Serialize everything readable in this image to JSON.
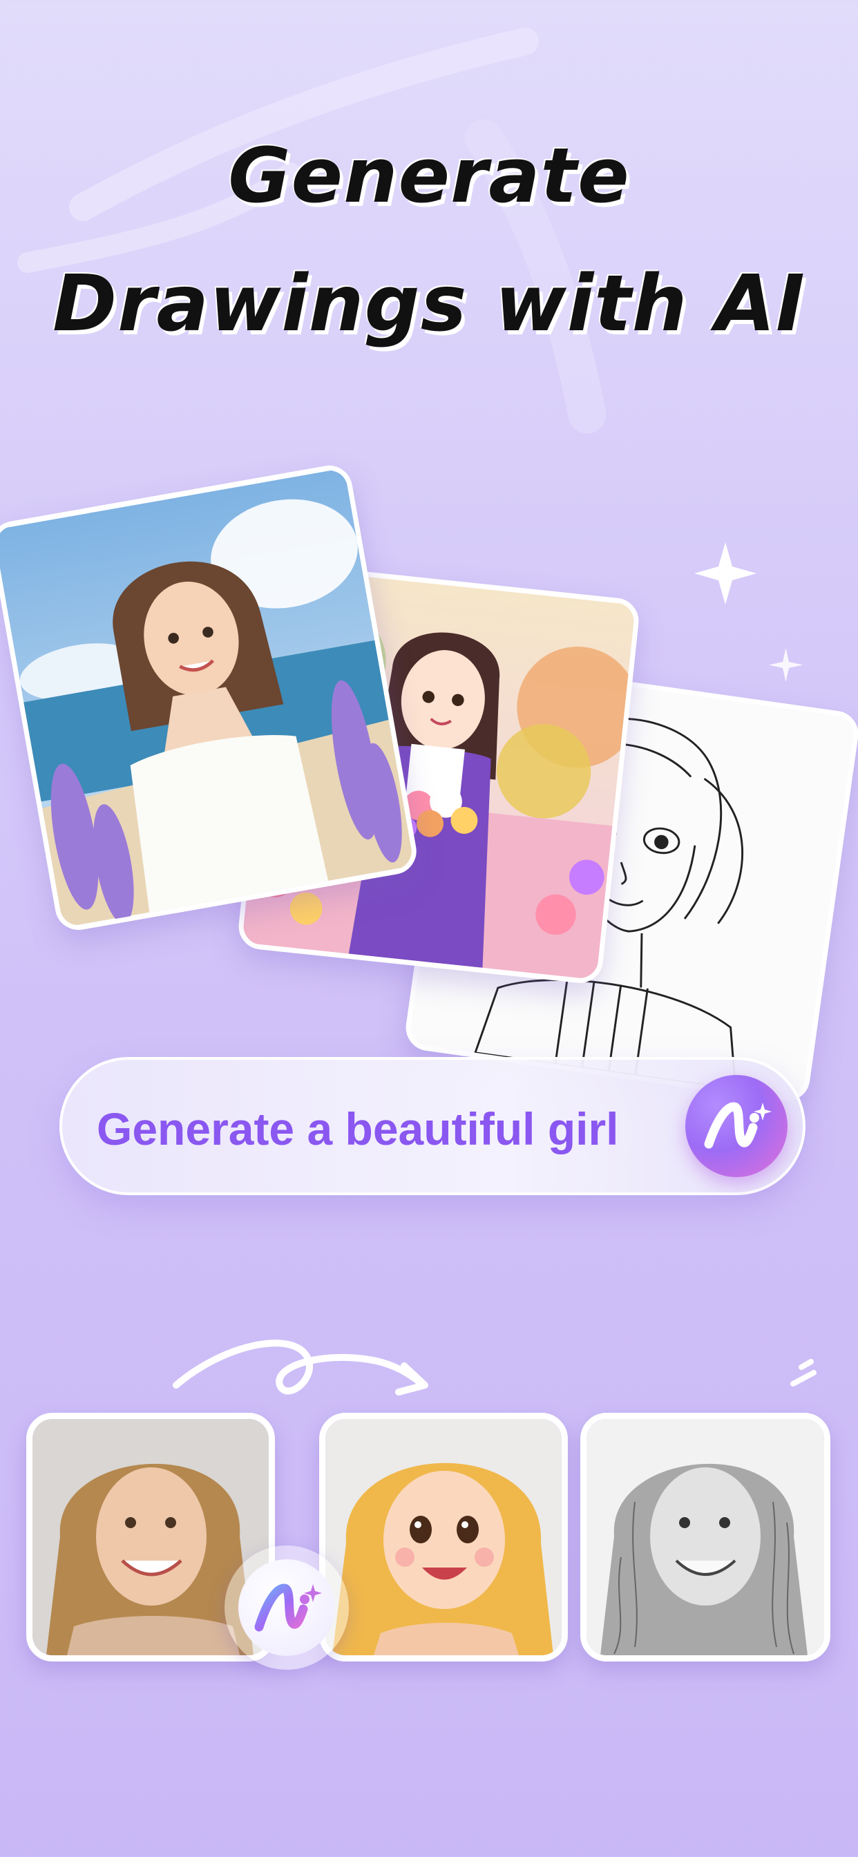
{
  "header": {
    "title_line1": "Generate",
    "title_line2": "Drawings with AI"
  },
  "gallery": {
    "cards": [
      "watercolor-girl-card",
      "flower-field-girl-card",
      "line-sketch-girl-card"
    ]
  },
  "prompt": {
    "text": "Generate a beautiful girl",
    "button_icon": "ai-brush-icon"
  },
  "transform": {
    "steps": [
      "original-photo",
      "cartoon-style",
      "pencil-sketch"
    ],
    "badge_icon": "ai-brush-icon"
  },
  "colors": {
    "background": "#d6cbf9",
    "accent": "#8a57f0",
    "button_gradient_start": "#9d6cf5",
    "button_gradient_end": "#e36fd8"
  }
}
